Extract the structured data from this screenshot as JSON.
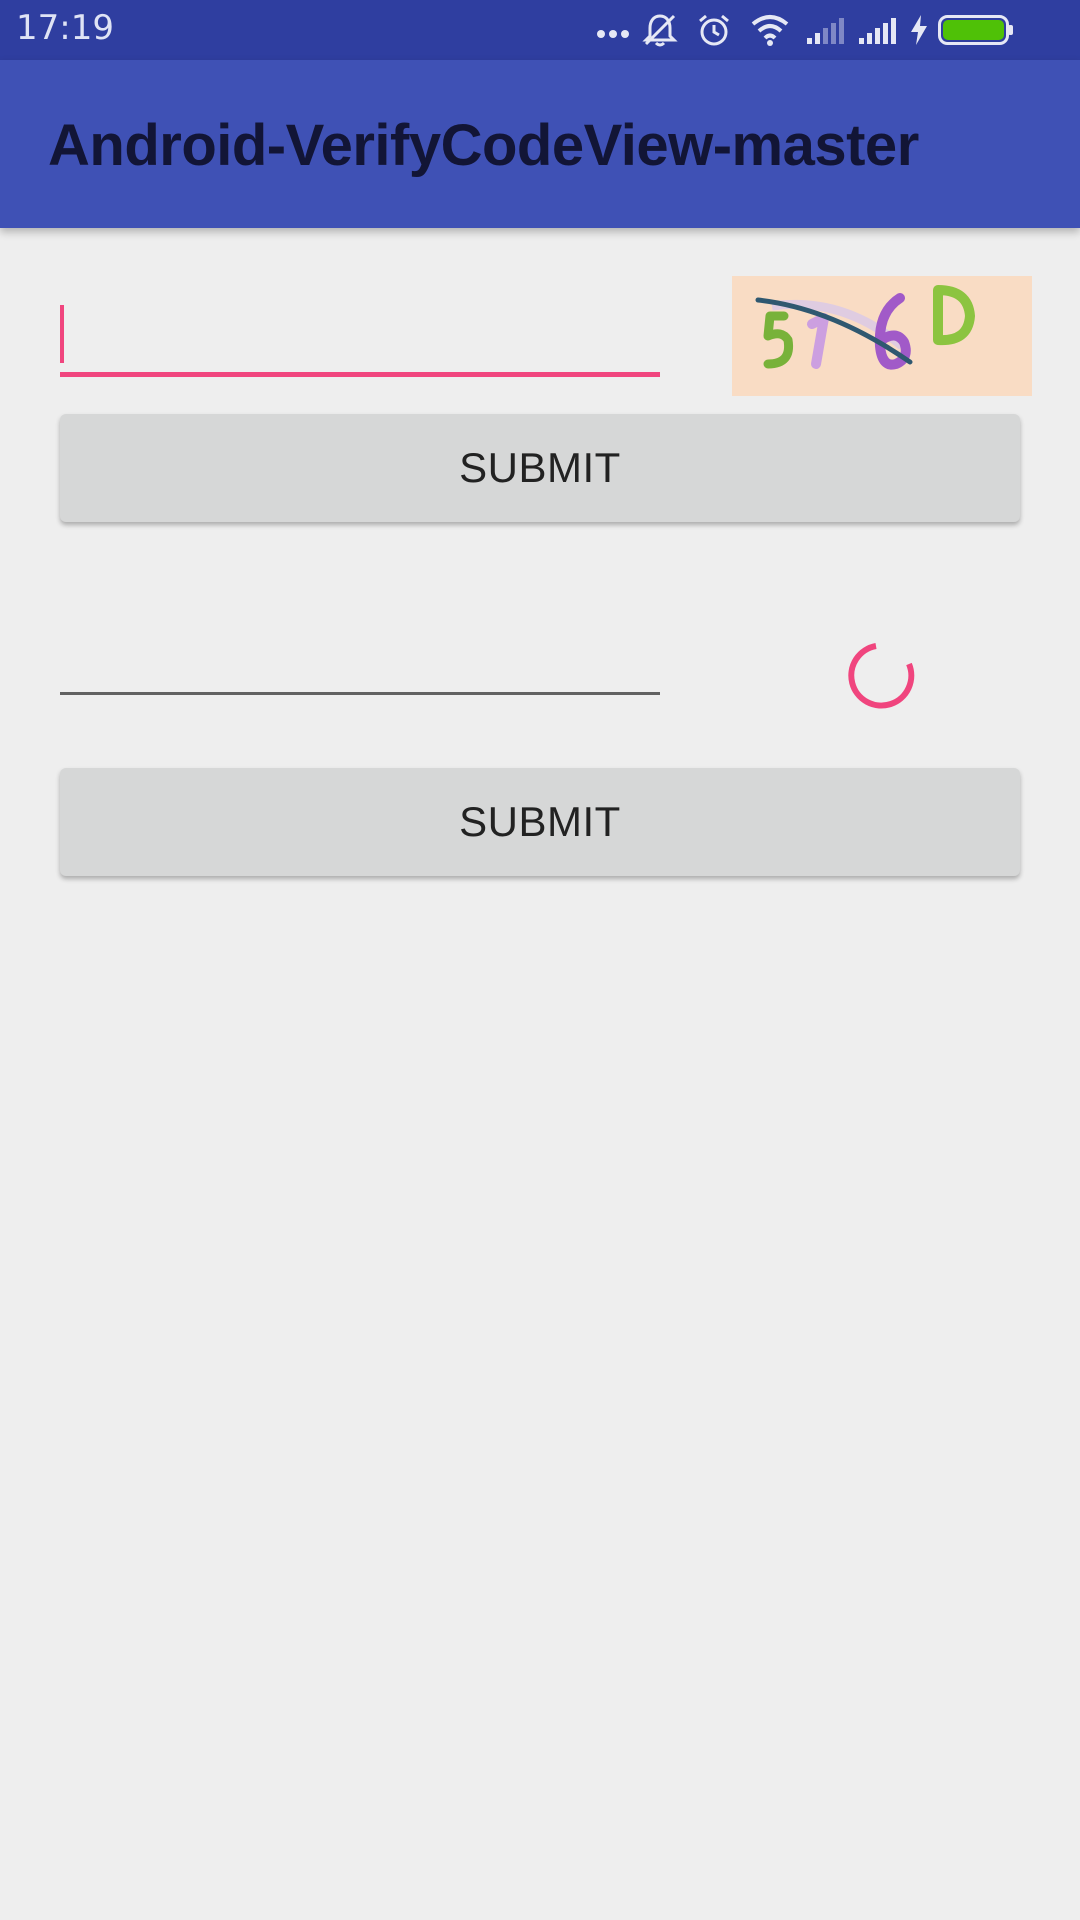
{
  "status_bar": {
    "time": "17:19",
    "icons": [
      "more-dots-icon",
      "silent-bell-icon",
      "alarm-icon",
      "wifi-icon",
      "signal-weak-icon",
      "signal-full-icon",
      "charging-icon",
      "battery-icon"
    ],
    "battery_color": "#4fc107"
  },
  "app_bar": {
    "title": "Android-VerifyCodeView-master",
    "color": "#3f51b5"
  },
  "form_1": {
    "input_value": "",
    "captcha_text": "516D",
    "captcha_background": "#f9dcc4",
    "submit_label": "SUBMIT"
  },
  "form_2": {
    "input_value": "",
    "loading": true,
    "submit_label": "SUBMIT"
  },
  "accent_color": "#f0457e"
}
